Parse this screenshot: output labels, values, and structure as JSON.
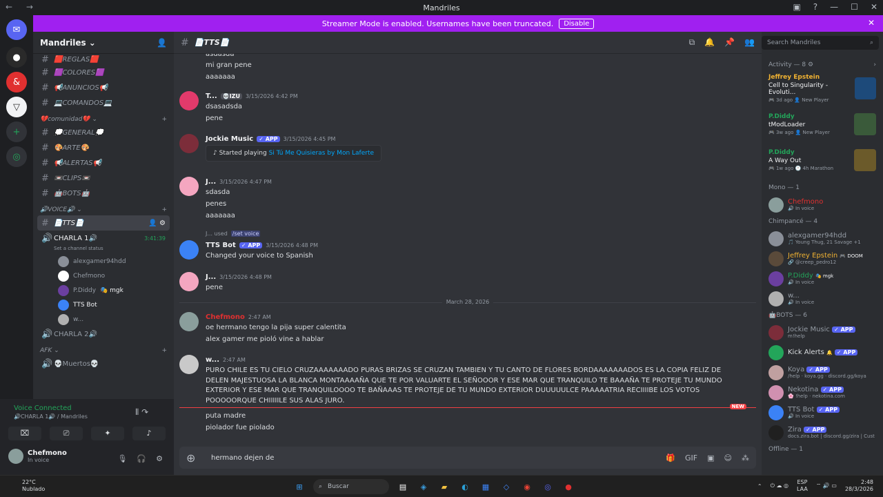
{
  "window": {
    "title": "Mandriles",
    "controls": [
      "▣",
      "?",
      "—",
      "☐",
      "✕"
    ]
  },
  "banner": {
    "text": "Streamer Mode is enabled. Usernames have been truncated.",
    "button": "Disable"
  },
  "server": {
    "name": "Mandriles"
  },
  "sidebar": {
    "top_channels": [
      {
        "label": "🟥REGLAS🟥"
      },
      {
        "label": "🟪COLORES🟪"
      },
      {
        "label": "📢ANUNCIOS📢"
      },
      {
        "label": "💻COMANDOS💻"
      }
    ],
    "category_community": "💔comunidad💔",
    "community_channels": [
      {
        "label": "💭GENERAL💭"
      },
      {
        "label": "🎨ARTE🎨"
      },
      {
        "label": "📢ALERTAS📢"
      },
      {
        "label": "📼CLIPS📼"
      },
      {
        "label": "🤖BOTS🤖"
      }
    ],
    "category_voice": "🔊VOICE🔊",
    "tts_channel": "📄TTS📄",
    "voice1": {
      "label": "CHARLA 1🔊",
      "timer": "3:41:39",
      "status": "Set a channel status"
    },
    "voice_users": [
      {
        "name": "alexgamer94hdd",
        "color": "#8a8f98"
      },
      {
        "name": "Chefmono",
        "color": "#ffffff"
      },
      {
        "name": "P.Diddy",
        "tag": "🎭 mgk",
        "color": "#6b3fa0"
      },
      {
        "name": "TTS Bot",
        "color": "#3b82f6"
      },
      {
        "name": "w...",
        "color": "#b0b0b0"
      }
    ],
    "voice2": {
      "label": "CHARLA 2🔊"
    },
    "category_afk": "AFK",
    "afk_channel": "💀Muertos💀"
  },
  "voice_panel": {
    "title": "Voice Connected",
    "subtitle": "🔊CHARLA 1🔊 / Mandriles"
  },
  "user": {
    "name": "Chefmono",
    "status": "In voice"
  },
  "channel_header": {
    "title": "📄TTS📄"
  },
  "messages": [
    {
      "lines": [
        "asdasda",
        "mi gran pene",
        "aaaaaaa"
      ]
    },
    {
      "name": "T...",
      "tag": "💀IZU",
      "time": "3/15/2026 4:42 PM",
      "lines": [
        "dsasadsda",
        "pene"
      ],
      "color": "#e23a6b"
    },
    {
      "name": "Jockie Music",
      "badge": "✓ APP",
      "time": "3/15/2026 4:45 PM",
      "embed_prefix": "Started playing",
      "embed_song": "Si Tú Me Quisieras by Mon Laferte",
      "color": "#7c2d3a"
    },
    {
      "name": "J...",
      "time": "3/15/2026 4:47 PM",
      "lines": [
        "sdasda",
        "penes",
        "aaaaaaa"
      ],
      "color": "#f4a6c0"
    },
    {
      "name": "TTS Bot",
      "badge": "✓ APP",
      "time": "3/15/2026 4:48 PM",
      "reply_user": "J... used",
      "reply_cmd": "/set voice",
      "lines": [
        "Changed your voice to Spanish"
      ],
      "color": "#3b82f6"
    },
    {
      "name": "J...",
      "time": "3/15/2026 4:48 PM",
      "lines": [
        "pene"
      ],
      "color": "#f4a6c0"
    },
    {
      "name": "Chefmono",
      "time": "2:47 AM",
      "lines": [
        "oe hermano tengo la pija super calentita",
        "alex gamer me pioló vine a hablar"
      ],
      "color": "#8a9e9c"
    },
    {
      "name": "w...",
      "time": "2:47 AM",
      "text": "PURO CHILE ES TU CIELO CRUZAAAAAAADO PURAS BRIZAS SE CRUZAN TAMBIEN Y TU CANTO DE FLORES BORDAAAAAAADOS ES LA COPIA FELIZ DE DELEN MAJESTUOSA LA BLANCA MONTAAAAÑA QUE TE POR VALUARTE EL SEÑOOOR Y ESE MAR QUE TRANQUILO TE BAAAÑA TE PROTEJE TU MUNDO EXTERIOR Y ESE MAR QUE TRANQUILOOOO TE BAÑAAAS TE PROTEJE DE TU MUNDO EXTERIOR DUUUUULCE PAAAAATRIA RECIIIIBE LOS VOTOS POOOOORQUE CHIIIIILE SUS ALAS JURO.",
      "color": "#c9c9c9"
    },
    {
      "lines": [
        "puta madre",
        "piolador fue piolado"
      ]
    }
  ],
  "date_divider": "March 28, 2026",
  "new_label": "NEW",
  "composer": {
    "value": "hermano dejen de"
  },
  "search": {
    "placeholder": "Search Mandriles"
  },
  "activity": {
    "title": "Activity — 8 ⚙",
    "items": [
      {
        "name": "Jeffrey Epstein",
        "game": "Cell to Singularity - Evoluti...",
        "meta_time": "🎮 3d ago",
        "meta_info": "👤 New Player",
        "color": "#f0b232",
        "thumb": "#1d4a7a"
      },
      {
        "name": "P.Diddy",
        "game": "tModLoader",
        "meta_time": "🎮 3w ago",
        "meta_info": "👤 New Player",
        "color": "#23a55a",
        "thumb": "#3a5a3a"
      },
      {
        "name": "P.Diddy",
        "game": "A Way Out",
        "meta_time": "🎮 1w ago",
        "meta_info": "🕐 4h Marathon",
        "color": "#23a55a",
        "thumb": "#6b5a2a"
      }
    ]
  },
  "member_groups": [
    {
      "title": "Mono — 1",
      "members": [
        {
          "name": "Chefmono",
          "status": "🔊 In voice",
          "color": "#e03030",
          "avatar": "#8a9e9c"
        }
      ]
    },
    {
      "title": "Chimpancé — 4",
      "members": [
        {
          "name": "alexgamer94hdd",
          "status": "🎵 Young Thug, 21 Savage +1",
          "color": "#949ba4",
          "avatar": "#8a8f98"
        },
        {
          "name": "Jeffrey Epstein",
          "tag": "🎮 DOOM",
          "status": "🔗 @creep_pedro12",
          "color": "#f0b232",
          "avatar": "#5a4a3a"
        },
        {
          "name": "P.Diddy",
          "tag": "🎭 mgk",
          "status": "🔊 In voice",
          "color": "#23a55a",
          "avatar": "#6b3fa0"
        },
        {
          "name": "w...",
          "status": "🔊 In voice",
          "color": "#949ba4",
          "avatar": "#b0b0b0"
        }
      ]
    },
    {
      "title": "🤖BOTS — 6",
      "members": [
        {
          "name": "Jockie Music",
          "badge": "✓ APP",
          "status": "m!help",
          "color": "#949ba4",
          "avatar": "#7c2d3a"
        },
        {
          "name": "Kick Alerts",
          "tag": "🔔",
          "badge": "✓ APP",
          "status": "",
          "color": "#dbdee1",
          "avatar": "#23a55a"
        },
        {
          "name": "Koya",
          "badge": "✓ APP",
          "status": "/help · koya.gg · discord.gg/koya",
          "color": "#949ba4",
          "avatar": "#c0a0a0"
        },
        {
          "name": "Nekotina",
          "badge": "✓ APP",
          "status": "🌸 !help · nekotina.com",
          "color": "#949ba4",
          "avatar": "#d090b0"
        },
        {
          "name": "TTS Bot",
          "badge": "✓ APP",
          "status": "🔊 In voice",
          "color": "#949ba4",
          "avatar": "#3b82f6"
        },
        {
          "name": "Zira",
          "badge": "✓ APP",
          "status": "docs.zira.bot | discord.gg/zira | Cust",
          "color": "#949ba4",
          "avatar": "#202020"
        }
      ]
    },
    {
      "title": "Offline — 1",
      "members": []
    }
  ],
  "taskbar": {
    "weather_temp": "22°C",
    "weather_desc": "Nublado",
    "search_placeholder": "Buscar",
    "lang": "ESP",
    "lang2": "LAA",
    "time": "2:48",
    "date": "28/3/2026"
  }
}
